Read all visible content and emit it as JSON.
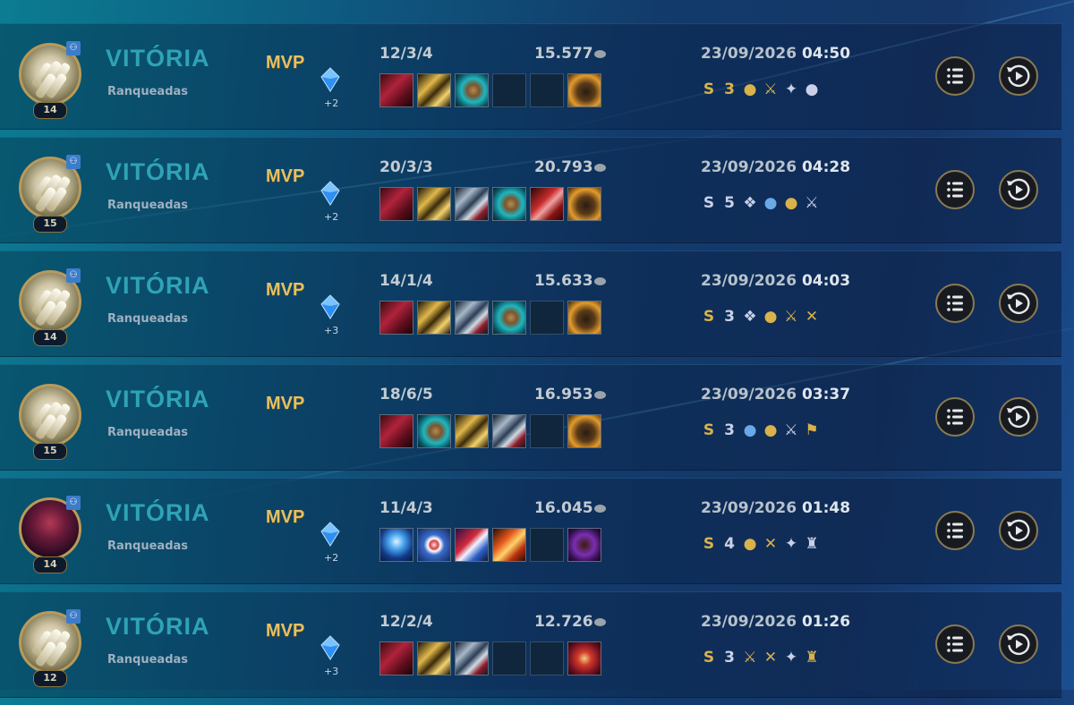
{
  "matches": [
    {
      "result": "VITÓRIA",
      "queue": "Ranqueadas",
      "mvp": "MVP",
      "level": "14",
      "champion": "light-claw",
      "lp": "+2",
      "kda": "12/3/4",
      "gold": "15.577",
      "date": "23/09/2026",
      "time": "04:50",
      "items": [
        "red-armor",
        "gold-blade",
        "teal-orb",
        "empty",
        "empty",
        "boots"
      ],
      "badges": [
        {
          "glyph": "S",
          "color": "gold"
        },
        {
          "glyph": "3",
          "color": "gold"
        },
        {
          "glyph": "●",
          "color": "gold"
        },
        {
          "glyph": "⚔",
          "color": "gold"
        },
        {
          "glyph": "✦",
          "color": "silver"
        },
        {
          "glyph": "●",
          "color": "silver"
        }
      ]
    },
    {
      "result": "VITÓRIA",
      "queue": "Ranqueadas",
      "mvp": "MVP",
      "level": "15",
      "champion": "light-claw",
      "lp": "+2",
      "kda": "20/3/3",
      "gold": "20.793",
      "date": "23/09/2026",
      "time": "04:28",
      "items": [
        "red-armor",
        "gold-blade",
        "silver-blade",
        "teal-orb",
        "red-blade",
        "boots"
      ],
      "badges": [
        {
          "glyph": "S",
          "color": "silver"
        },
        {
          "glyph": "5",
          "color": "silver"
        },
        {
          "glyph": "❖",
          "color": "silver"
        },
        {
          "glyph": "●",
          "color": "blue"
        },
        {
          "glyph": "●",
          "color": "gold"
        },
        {
          "glyph": "⚔",
          "color": "silver"
        }
      ]
    },
    {
      "result": "VITÓRIA",
      "queue": "Ranqueadas",
      "mvp": "MVP",
      "level": "14",
      "champion": "light-claw",
      "lp": "+3",
      "kda": "14/1/4",
      "gold": "15.633",
      "date": "23/09/2026",
      "time": "04:03",
      "items": [
        "red-armor",
        "gold-blade",
        "silver-blade",
        "teal-orb",
        "empty",
        "boots"
      ],
      "badges": [
        {
          "glyph": "S",
          "color": "gold"
        },
        {
          "glyph": "3",
          "color": "silver"
        },
        {
          "glyph": "❖",
          "color": "silver"
        },
        {
          "glyph": "●",
          "color": "gold"
        },
        {
          "glyph": "⚔",
          "color": "gold"
        },
        {
          "glyph": "✕",
          "color": "gold"
        }
      ]
    },
    {
      "result": "VITÓRIA",
      "queue": "Ranqueadas",
      "mvp": "MVP",
      "level": "15",
      "champion": "light-claw",
      "lp": "",
      "kda": "18/6/5",
      "gold": "16.953",
      "date": "23/09/2026",
      "time": "03:37",
      "items": [
        "red-armor",
        "teal-orb",
        "gold-blade",
        "silver-blade",
        "empty",
        "boots"
      ],
      "badges": [
        {
          "glyph": "S",
          "color": "gold"
        },
        {
          "glyph": "3",
          "color": "silver"
        },
        {
          "glyph": "●",
          "color": "blue"
        },
        {
          "glyph": "●",
          "color": "gold"
        },
        {
          "glyph": "⚔",
          "color": "silver"
        },
        {
          "glyph": "⚑",
          "color": "gold"
        }
      ]
    },
    {
      "result": "VITÓRIA",
      "queue": "Ranqueadas",
      "mvp": "MVP",
      "level": "14",
      "champion": "dark-assassin",
      "lp": "+2",
      "kda": "11/4/3",
      "gold": "16.045",
      "date": "23/09/2026",
      "time": "01:48",
      "items": [
        "blue-staff",
        "target-orb",
        "red-blue-blade",
        "fire-blade",
        "empty",
        "purple-gauntlet"
      ],
      "badges": [
        {
          "glyph": "S",
          "color": "gold"
        },
        {
          "glyph": "4",
          "color": "silver"
        },
        {
          "glyph": "●",
          "color": "gold"
        },
        {
          "glyph": "✕",
          "color": "gold"
        },
        {
          "glyph": "✦",
          "color": "silver"
        },
        {
          "glyph": "♜",
          "color": "silver"
        }
      ]
    },
    {
      "result": "VITÓRIA",
      "queue": "Ranqueadas",
      "mvp": "MVP",
      "level": "12",
      "champion": "light-claw",
      "lp": "+3",
      "kda": "12/2/4",
      "gold": "12.726",
      "date": "23/09/2026",
      "time": "01:26",
      "items": [
        "red-armor",
        "gold-blade",
        "silver-blade",
        "empty",
        "empty",
        "red-maw"
      ],
      "badges": [
        {
          "glyph": "S",
          "color": "gold"
        },
        {
          "glyph": "3",
          "color": "silver"
        },
        {
          "glyph": "⚔",
          "color": "gold"
        },
        {
          "glyph": "✕",
          "color": "gold"
        },
        {
          "glyph": "✦",
          "color": "silver"
        },
        {
          "glyph": "♜",
          "color": "gold"
        }
      ]
    }
  ],
  "icons": {
    "details": "list-icon",
    "replay": "replay-icon",
    "party": "party-icon",
    "lp": "blue-crystal-icon",
    "gold": "gold-coin-icon"
  },
  "colors": {
    "result": "#2fa3b6",
    "mvp": "#e6c062",
    "button_border": "#8a7a52"
  }
}
